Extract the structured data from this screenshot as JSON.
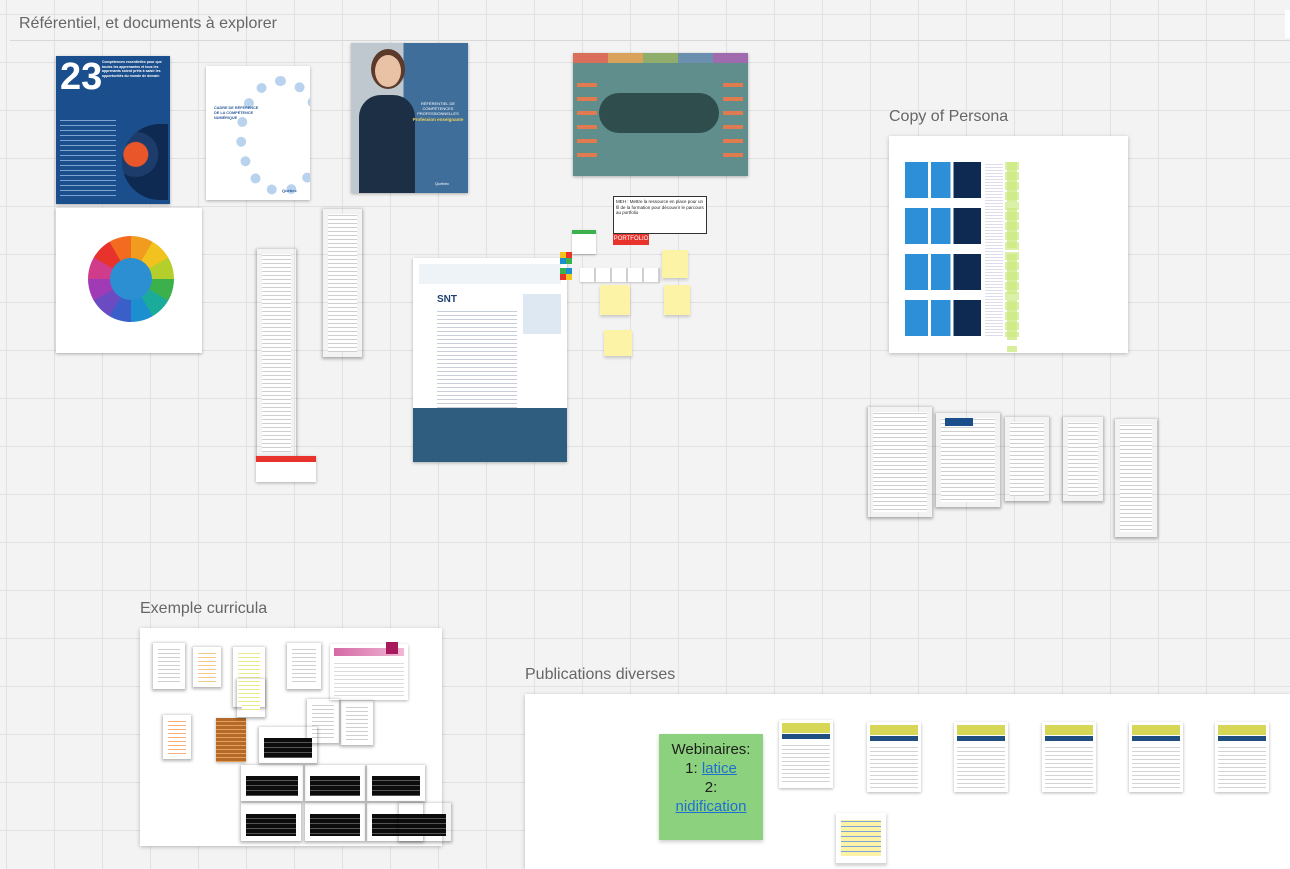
{
  "board": {
    "frames": {
      "referentiel": {
        "title": "Référentiel, et documents à explorer"
      },
      "persona": {
        "title": "Copy of Persona"
      },
      "curricula": {
        "title": "Exemple curricula"
      },
      "publications": {
        "title": "Publications diverses"
      }
    },
    "cover23": {
      "number": "23",
      "heading": "Compétences essentielles pour que toutes les apprenantes et tous les apprenants soient prêts à saisir les opportunités du monde de demain"
    },
    "cadre_doc": {
      "title": "CADRE DE RÉFÉRENCE DE LA COMPÉTENCE NUMÉRIQUE",
      "footer": "Québec"
    },
    "teacher_poster": {
      "title": "RÉFÉRENTIEL DE COMPÉTENCES PROFESSIONNELLES",
      "subtitle": "Profession enseignante",
      "footer": "Québec"
    },
    "snt_page": {
      "badge": "SNT"
    },
    "portfolio_note": {
      "text": "MEH : Mettre la ressource en place pour un fil de la formation pour découvrir le parcours au portfolio",
      "badge": "PORTFOLIO"
    },
    "webinar_note": {
      "title": "Webinaires:",
      "item1_prefix": "1: ",
      "item1_link": "latice",
      "item2_prefix": "2:",
      "item2_link": "nidification"
    },
    "colors": {
      "accent_red": "#e8322c",
      "cover_blue": "#1a4e8c",
      "persona_blue": "#2d8fd8",
      "sticky_yellow": "#fdf3a6",
      "sticky_green": "#8cd17d",
      "link_blue": "#1f6fd1"
    }
  }
}
